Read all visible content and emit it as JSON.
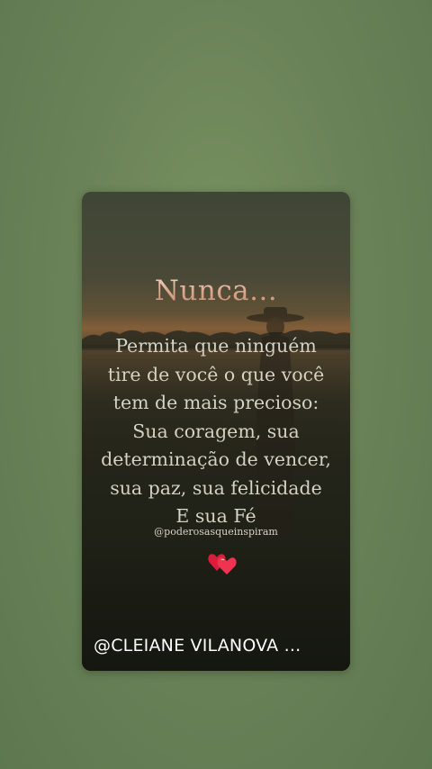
{
  "post": {
    "title": "Nunca...",
    "message_lines": [
      "Permita que ninguém",
      "tire de você o que você",
      "tem de mais precioso:",
      "Sua coragem, sua",
      "determinação de vencer,",
      "sua paz, sua felicidade",
      "E sua Fé"
    ],
    "source_handle": "@poderosasqueinspiram",
    "hearts_icon": "two-hearts-icon",
    "credit": "@CLEIANE VILANOVA ..."
  },
  "colors": {
    "background": "#6c8459",
    "heart": "#e5233f"
  }
}
